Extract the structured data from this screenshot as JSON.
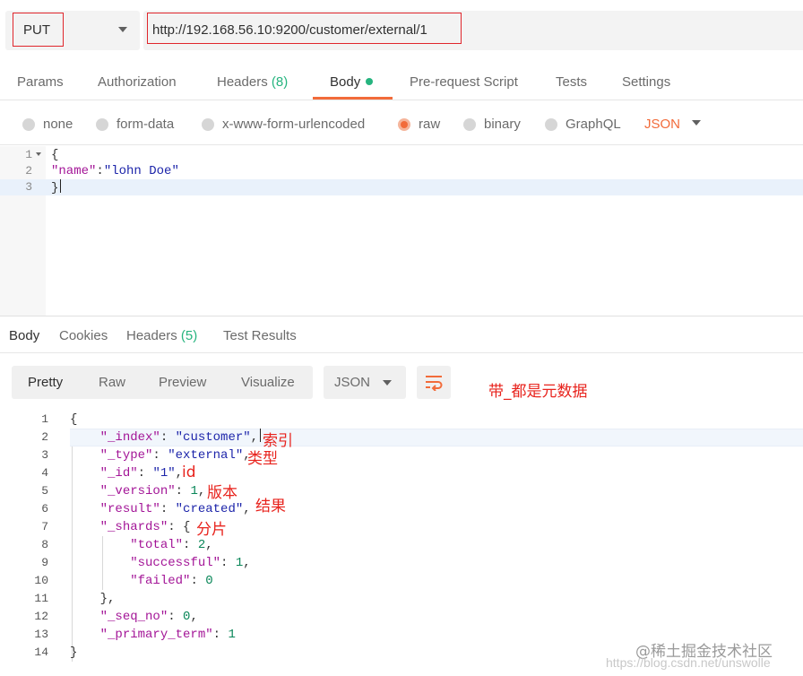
{
  "request": {
    "method": "PUT",
    "url": "http://192.168.56.10:9200/customer/external/1"
  },
  "req_tabs": [
    {
      "label": "Params"
    },
    {
      "label": "Authorization"
    },
    {
      "label": "Headers",
      "count": "(8)"
    },
    {
      "label": "Body",
      "active": true
    },
    {
      "label": "Pre-request Script"
    },
    {
      "label": "Tests"
    },
    {
      "label": "Settings"
    }
  ],
  "body_types": [
    {
      "label": "none"
    },
    {
      "label": "form-data"
    },
    {
      "label": "x-www-form-urlencoded"
    },
    {
      "label": "raw",
      "checked": true
    },
    {
      "label": "binary"
    },
    {
      "label": "GraphQL"
    }
  ],
  "body_format": "JSON",
  "request_body": {
    "line_numbers": [
      "1",
      "2",
      "3"
    ],
    "open_brace": "{",
    "name_key": "\"name\"",
    "colon": ":",
    "name_value": "\"lohn Doe\"",
    "close_brace": "}"
  },
  "resp_tabs": [
    {
      "label": "Body",
      "active": true
    },
    {
      "label": "Cookies"
    },
    {
      "label": "Headers",
      "count": "(5)"
    },
    {
      "label": "Test Results"
    }
  ],
  "view_modes": [
    "Pretty",
    "Raw",
    "Preview",
    "Visualize"
  ],
  "response_format": "JSON",
  "note_metadata": "带_都是元数据",
  "response": {
    "line_numbers": [
      "1",
      "2",
      "3",
      "4",
      "5",
      "6",
      "7",
      "8",
      "9",
      "10",
      "11",
      "12",
      "13",
      "14"
    ],
    "index_key": "\"_index\"",
    "index_val": "\"customer\"",
    "type_key": "\"_type\"",
    "type_val": "\"external\"",
    "id_key": "\"_id\"",
    "id_val": "\"1\"",
    "version_key": "\"_version\"",
    "version_val": "1",
    "result_key": "\"result\"",
    "result_val": "\"created\"",
    "shards_key": "\"_shards\"",
    "total_key": "\"total\"",
    "total_val": "2",
    "successful_key": "\"successful\"",
    "successful_val": "1",
    "failed_key": "\"failed\"",
    "failed_val": "0",
    "seq_key": "\"_seq_no\"",
    "seq_val": "0",
    "term_key": "\"_primary_term\"",
    "term_val": "1"
  },
  "annotations": {
    "index": "索引",
    "type": "类型",
    "id": "id",
    "version": "版本",
    "result": "结果",
    "shards": "分片"
  },
  "watermark": {
    "main": "@稀土掘金技术社区",
    "sub": "https://blog.csdn.net/unswolle"
  },
  "colors": {
    "accent": "#f26b3a",
    "success": "#26b47f",
    "annotation_red": "#e8231d",
    "json_key": "#a31597",
    "json_string": "#1d25aa",
    "json_number": "#098658"
  }
}
